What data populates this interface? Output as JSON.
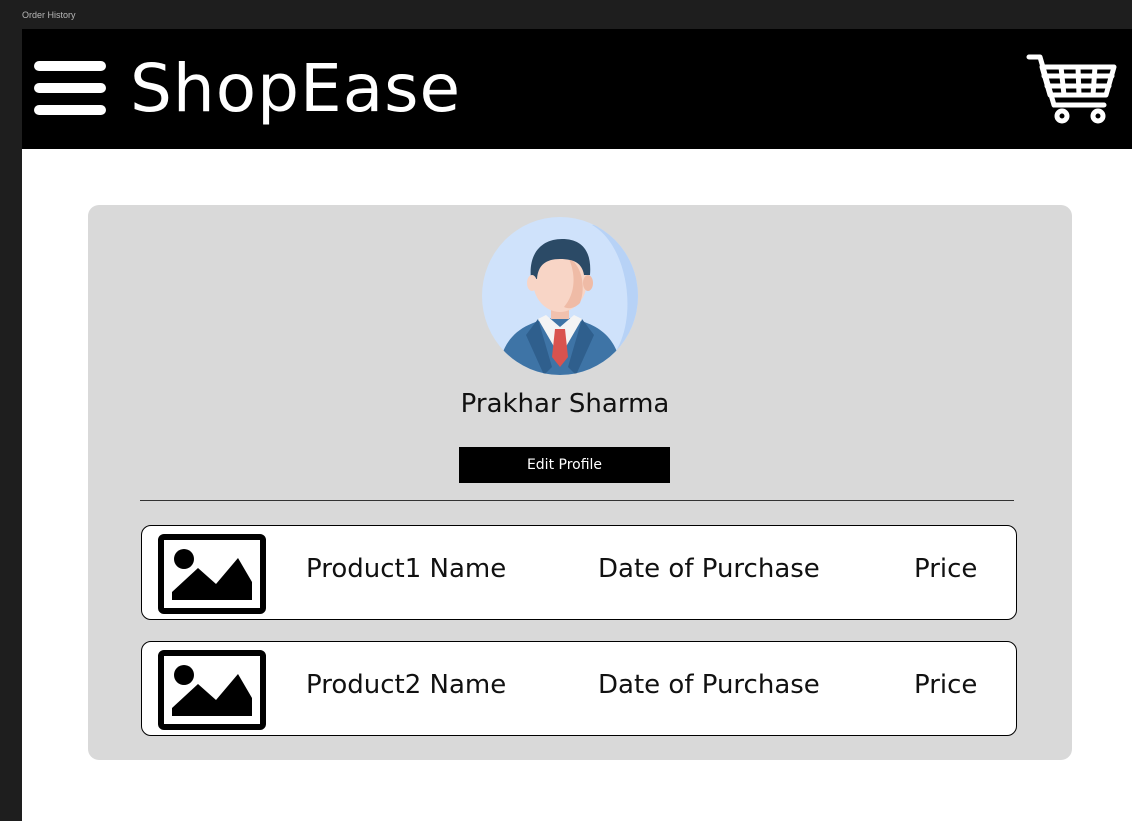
{
  "frame": {
    "label": "Order History",
    "chrome_color": "#1e1e1e"
  },
  "header": {
    "brand": "ShopEase",
    "background": "#000000",
    "menu_icon": "hamburger-menu-icon",
    "cart_icon": "shopping-cart-icon"
  },
  "profile": {
    "avatar_icon": "user-avatar-icon",
    "name": "Prakhar Sharma",
    "edit_button_label": "Edit Profile",
    "card_color": "#d9d9d9"
  },
  "orders": [
    {
      "thumbnail_icon": "image-placeholder-icon",
      "product_name": "Product1 Name",
      "date": "Date of Purchase",
      "price": "Price"
    },
    {
      "thumbnail_icon": "image-placeholder-icon",
      "product_name": "Product2 Name",
      "date": "Date of Purchase",
      "price": "Price"
    }
  ]
}
